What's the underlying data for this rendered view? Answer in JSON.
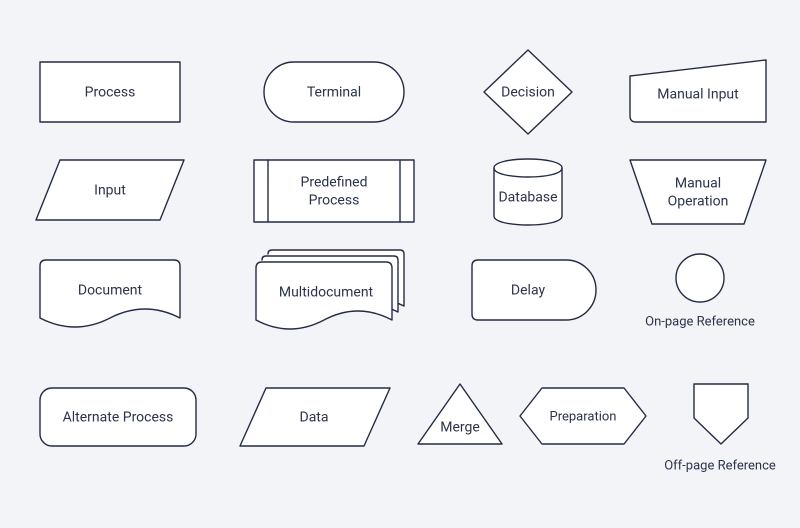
{
  "shapes": {
    "process": {
      "label": "Process"
    },
    "terminal": {
      "label": "Terminal"
    },
    "decision": {
      "label": "Decision"
    },
    "manual_input": {
      "label": "Manual Input"
    },
    "input": {
      "label": "Input"
    },
    "predefined_process": {
      "line1": "Predefined",
      "line2": "Process"
    },
    "database": {
      "label": "Database"
    },
    "manual_operation": {
      "line1": "Manual",
      "line2": "Operation"
    },
    "document": {
      "label": "Document"
    },
    "multidocument": {
      "label": "Multidocument"
    },
    "delay": {
      "label": "Delay"
    },
    "on_page_reference": {
      "label": "On-page Reference"
    },
    "alternate_process": {
      "label": "Alternate Process"
    },
    "data": {
      "label": "Data"
    },
    "merge": {
      "label": "Merge"
    },
    "preparation": {
      "label": "Preparation"
    },
    "off_page_reference": {
      "label": "Off-page Reference"
    }
  }
}
